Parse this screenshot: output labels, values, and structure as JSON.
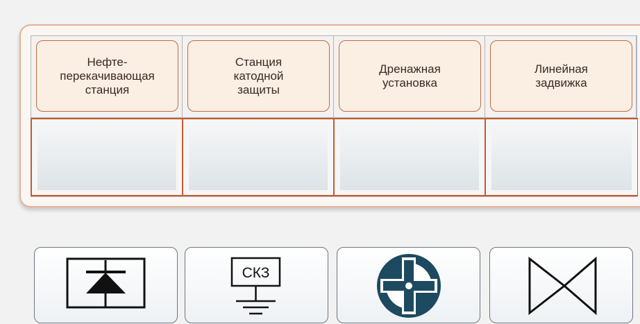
{
  "legend": {
    "headers": [
      {
        "label": "Нефте-\nперекачивающая\nстанция"
      },
      {
        "label": "Станция\nкатодной\nзащиты"
      },
      {
        "label": "Дренажная\nустановка"
      },
      {
        "label": "Линейная\nзадвижка"
      }
    ],
    "slots": [
      "",
      "",
      "",
      ""
    ]
  },
  "palette": {
    "icons": [
      {
        "icon": "pump-station-icon"
      },
      {
        "icon": "cathodic-protection-station-icon",
        "text": "СКЗ"
      },
      {
        "icon": "drainage-unit-icon"
      },
      {
        "icon": "line-valve-icon"
      }
    ]
  },
  "colors": {
    "accent_border": "#c65a2f",
    "header_border": "#b96f45",
    "icon_dark": "#1d4a60"
  }
}
